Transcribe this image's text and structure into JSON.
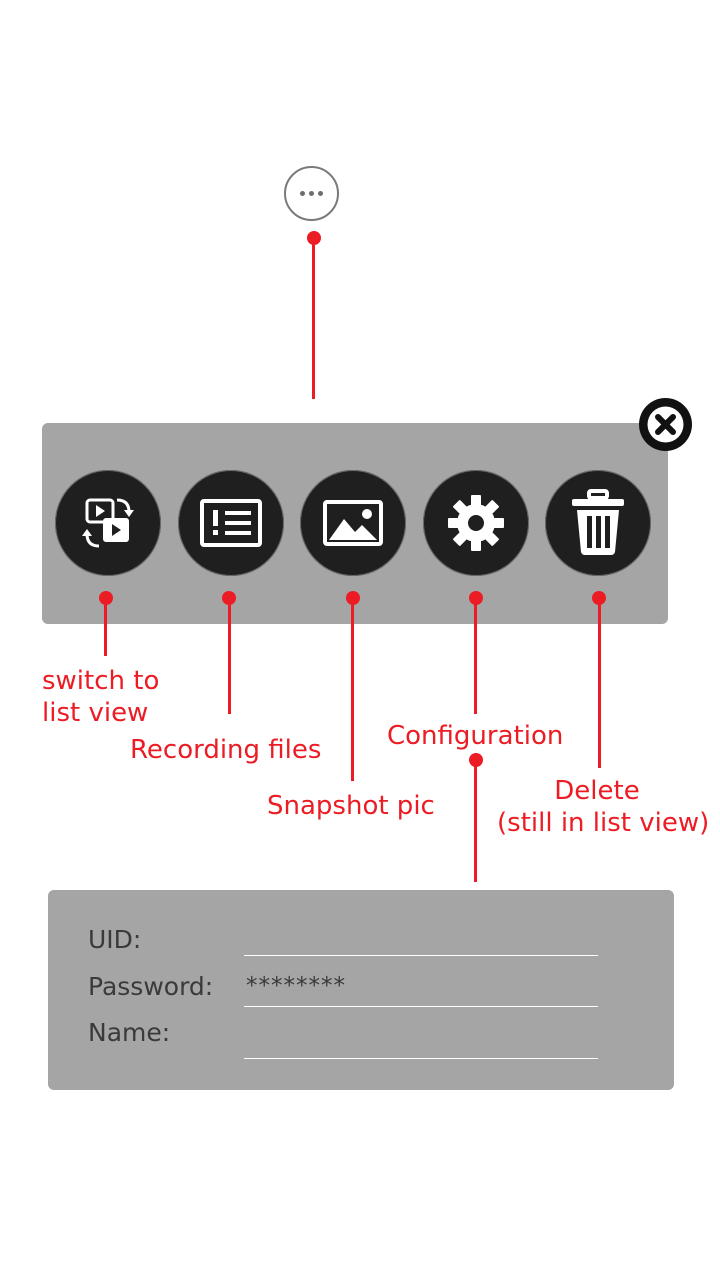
{
  "top": {
    "more_icon": "ellipsis-icon"
  },
  "toolbar": {
    "buttons": [
      {
        "icon": "switch-view-icon"
      },
      {
        "icon": "recording-list-icon"
      },
      {
        "icon": "image-icon"
      },
      {
        "icon": "gear-icon"
      },
      {
        "icon": "trash-icon"
      }
    ],
    "close_icon": "close-icon"
  },
  "annotations": {
    "switch_view": [
      "switch to",
      "list view"
    ],
    "recording_files": "Recording files",
    "snapshot_pic": "Snapshot pic",
    "configuration": "Configuration",
    "delete": [
      "Delete",
      "(still in list view)"
    ],
    "color": "#ec1c24"
  },
  "form": {
    "uid_label": "UID:",
    "uid_value": "",
    "password_label": "Password:",
    "password_value": "********",
    "name_label": "Name:",
    "name_value": ""
  },
  "colors": {
    "panel": "#a5a5a5",
    "button": "#1f1f1f",
    "accent": "#ec1c24"
  }
}
